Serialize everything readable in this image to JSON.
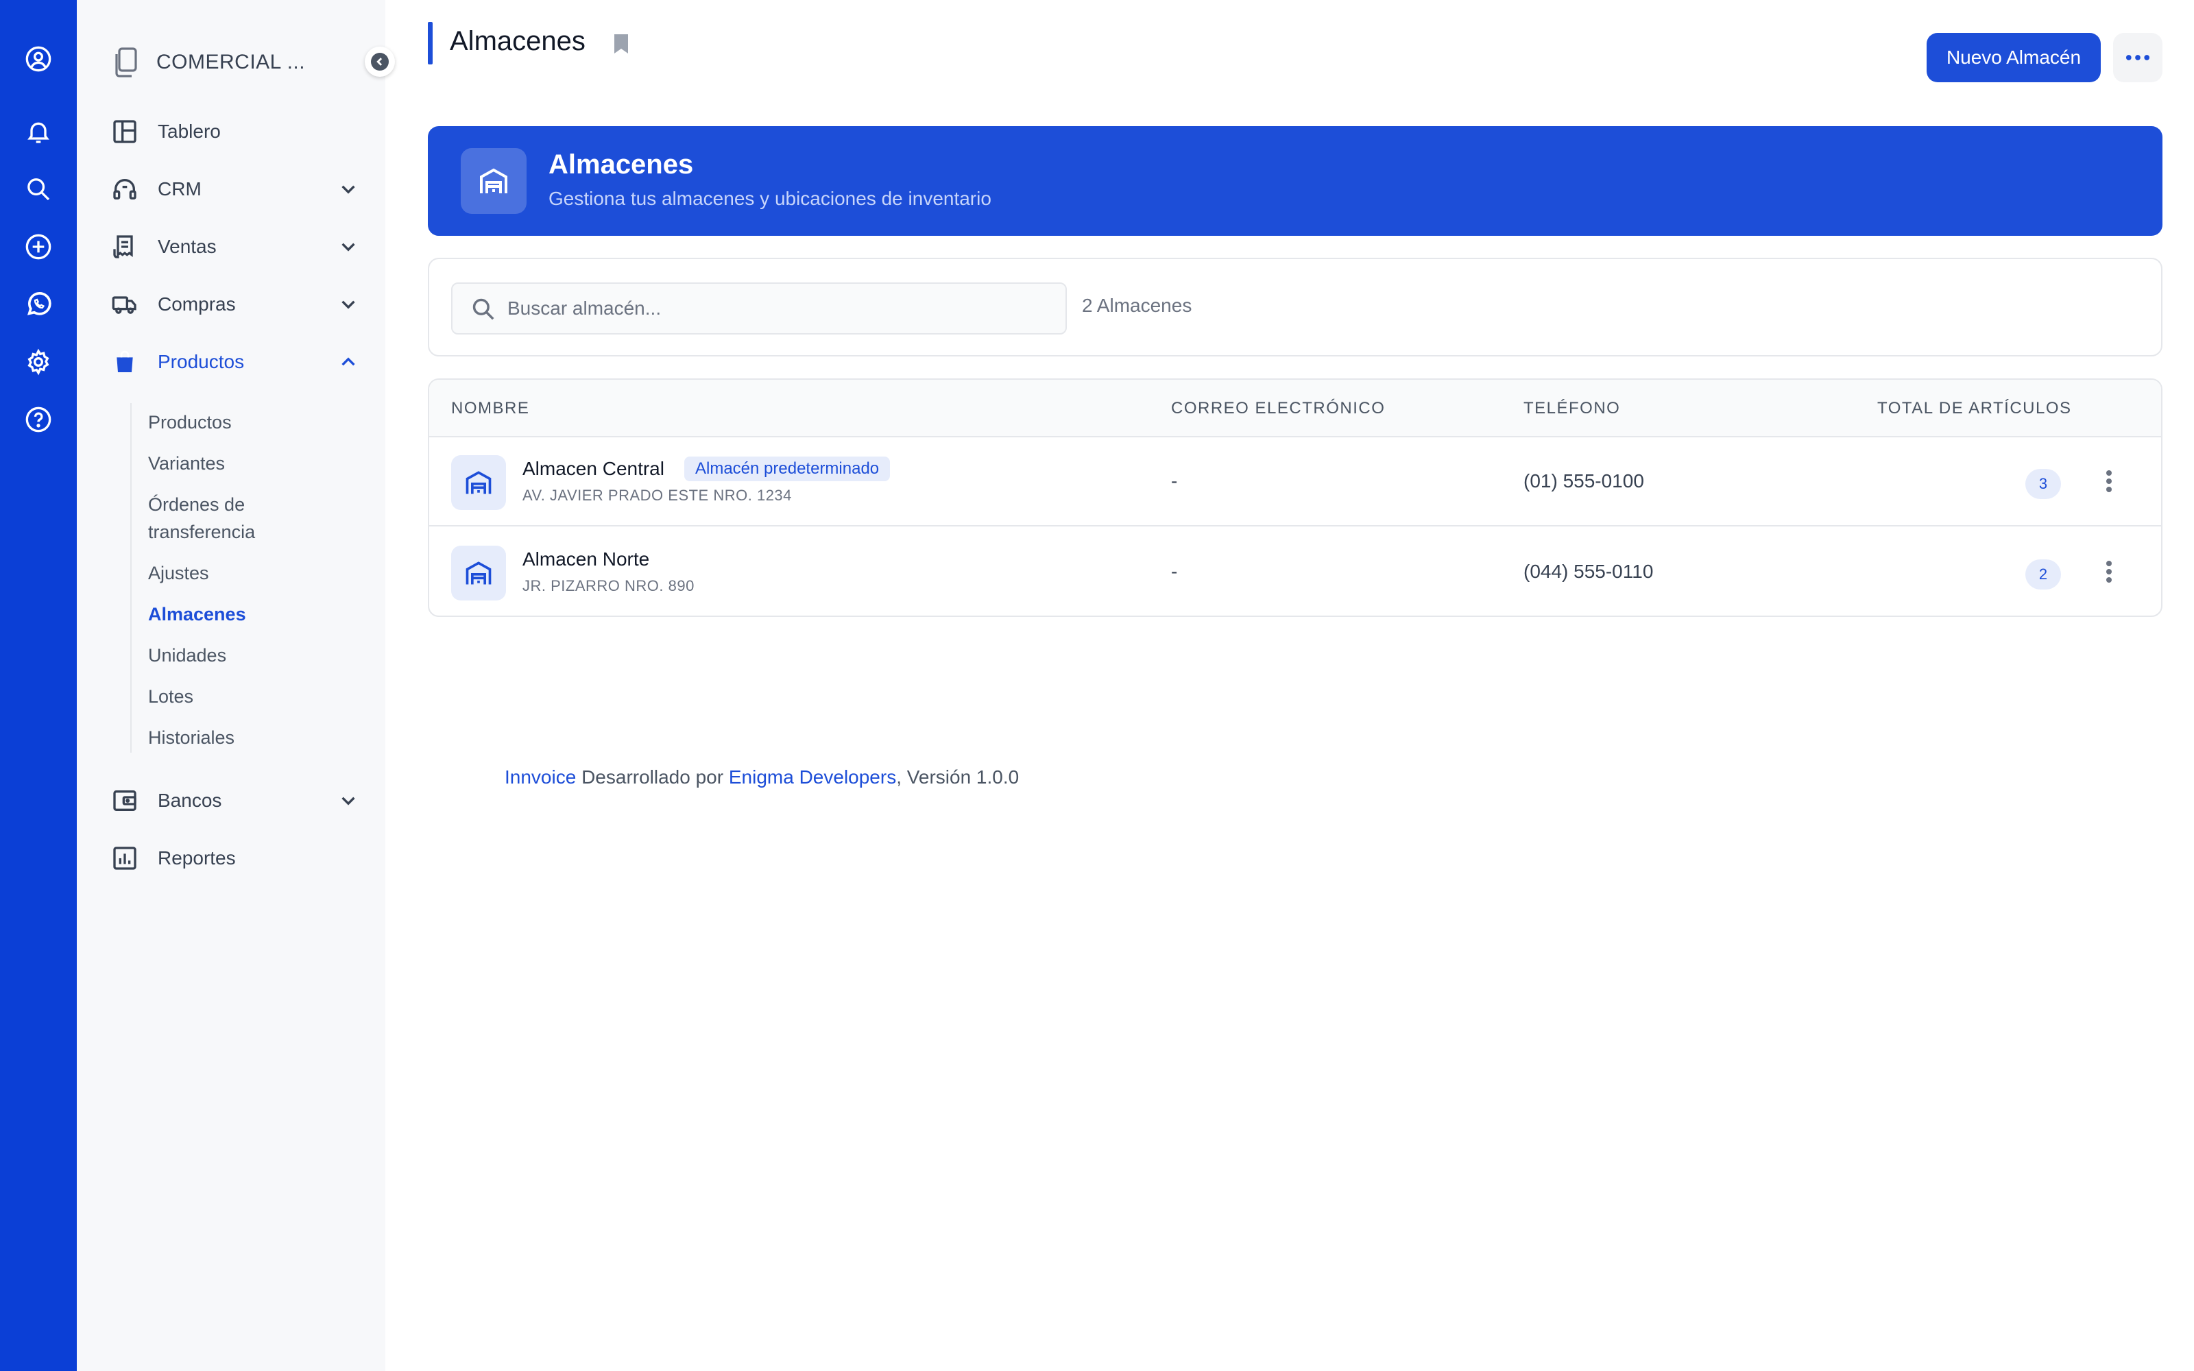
{
  "company": {
    "name": "COMERCIAL ..."
  },
  "sidebar": {
    "items": [
      {
        "label": "Tablero"
      },
      {
        "label": "CRM"
      },
      {
        "label": "Ventas"
      },
      {
        "label": "Compras"
      },
      {
        "label": "Productos"
      },
      {
        "label": "Bancos"
      },
      {
        "label": "Reportes"
      }
    ],
    "subitems": [
      {
        "label": "Productos"
      },
      {
        "label": "Variantes"
      },
      {
        "label": "Órdenes de transferencia"
      },
      {
        "label": "Ajustes"
      },
      {
        "label": "Almacenes"
      },
      {
        "label": "Unidades"
      },
      {
        "label": "Lotes"
      },
      {
        "label": "Historiales"
      }
    ]
  },
  "header": {
    "title": "Almacenes",
    "new_button": "Nuevo Almacén"
  },
  "hero": {
    "title": "Almacenes",
    "subtitle": "Gestiona tus almacenes y ubicaciones de inventario"
  },
  "search": {
    "placeholder": "Buscar almacén...",
    "count": "2 Almacenes"
  },
  "table": {
    "headers": [
      "NOMBRE",
      "CORREO ELECTRÓNICO",
      "TELÉFONO",
      "TOTAL DE ARTÍCULOS"
    ],
    "rows": [
      {
        "name": "Almacen Central",
        "badge": "Almacén predeterminado",
        "address": "AV. JAVIER PRADO ESTE NRO. 1234",
        "email": "-",
        "phone": "(01) 555-0100",
        "total": "3"
      },
      {
        "name": "Almacen Norte",
        "address": "JR. PIZARRO NRO. 890",
        "email": "-",
        "phone": "(044) 555-0110",
        "total": "2"
      }
    ]
  },
  "footer": {
    "brand": "Innvoice",
    "middle": " Desarrollado por ",
    "developer": "Enigma Developers",
    "version": ", Versión 1.0.0"
  },
  "colors": {
    "primary": "#1d4ed8",
    "rail": "#0b3fd6"
  }
}
